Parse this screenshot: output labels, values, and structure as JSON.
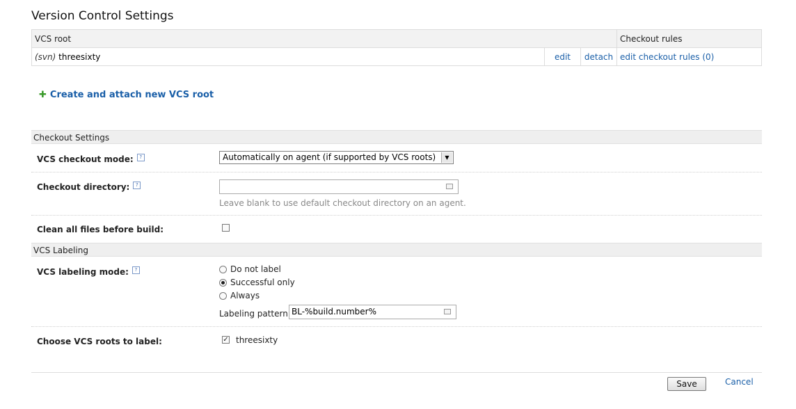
{
  "page": {
    "title": "Version Control Settings"
  },
  "vcs_table": {
    "headers": {
      "root": "VCS root",
      "checkout_rules": "Checkout rules"
    },
    "rows": [
      {
        "type": "(svn)",
        "name": "threesixty",
        "edit": "edit",
        "detach": "detach",
        "rules": "edit checkout rules (0)"
      }
    ]
  },
  "create_link": {
    "icon": "plus-icon",
    "label": "Create and attach new VCS root"
  },
  "checkout_settings": {
    "heading": "Checkout Settings",
    "mode_label": "VCS checkout mode:",
    "mode_value": "Automatically on agent (if supported by VCS roots)",
    "dir_label": "Checkout directory:",
    "dir_value": "",
    "dir_hint": "Leave blank to use default checkout directory on an agent.",
    "clean_label": "Clean all files before build:"
  },
  "labeling": {
    "heading": "VCS Labeling",
    "mode_label": "VCS labeling mode:",
    "options": [
      "Do not label",
      "Successful only",
      "Always"
    ],
    "selected": "Successful only",
    "pattern_label": "Labeling pattern:",
    "pattern_value": "BL-%build.number%",
    "roots_label": "Choose VCS roots to label:",
    "roots": [
      {
        "name": "threesixty",
        "checked": true
      }
    ]
  },
  "footer": {
    "save": "Save",
    "cancel": "Cancel"
  }
}
